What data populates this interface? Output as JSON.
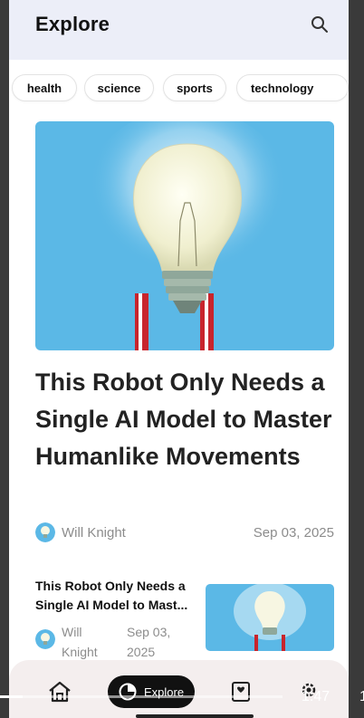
{
  "header": {
    "title": "Explore"
  },
  "categories": [
    "health",
    "science",
    "sports",
    "technology"
  ],
  "featured": {
    "headline": "This Robot Only Needs a Single AI Model to Master Humanlike Movements",
    "author": "Will Knight",
    "date": "Sep 03, 2025"
  },
  "list": [
    {
      "title": "This Robot Only Needs a Single AI Model to Mast...",
      "author_line1": "Will",
      "author_line2": "Knight",
      "date_line1": "Sep 03,",
      "date_line2": "2025"
    }
  ],
  "nav": {
    "items": [
      "home",
      "explore",
      "bookmarks",
      "settings"
    ],
    "active_label": "Explore"
  },
  "player": {
    "time": "1:47",
    "progress": 0.08,
    "edge_text": "1"
  },
  "colors": {
    "hero_bg": "#5bb8e6",
    "topbar": "#eceef8",
    "navbar": "#f4eeee",
    "pill": "#111111"
  }
}
